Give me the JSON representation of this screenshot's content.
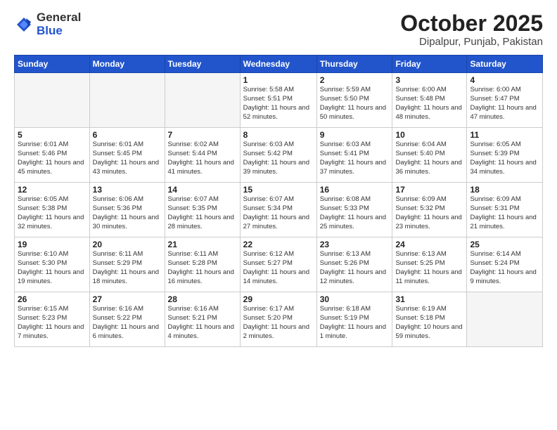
{
  "logo": {
    "general": "General",
    "blue": "Blue"
  },
  "header": {
    "month": "October 2025",
    "location": "Dipalpur, Punjab, Pakistan"
  },
  "weekdays": [
    "Sunday",
    "Monday",
    "Tuesday",
    "Wednesday",
    "Thursday",
    "Friday",
    "Saturday"
  ],
  "weeks": [
    [
      {
        "day": "",
        "info": ""
      },
      {
        "day": "",
        "info": ""
      },
      {
        "day": "",
        "info": ""
      },
      {
        "day": "1",
        "info": "Sunrise: 5:58 AM\nSunset: 5:51 PM\nDaylight: 11 hours and 52 minutes."
      },
      {
        "day": "2",
        "info": "Sunrise: 5:59 AM\nSunset: 5:50 PM\nDaylight: 11 hours and 50 minutes."
      },
      {
        "day": "3",
        "info": "Sunrise: 6:00 AM\nSunset: 5:48 PM\nDaylight: 11 hours and 48 minutes."
      },
      {
        "day": "4",
        "info": "Sunrise: 6:00 AM\nSunset: 5:47 PM\nDaylight: 11 hours and 47 minutes."
      }
    ],
    [
      {
        "day": "5",
        "info": "Sunrise: 6:01 AM\nSunset: 5:46 PM\nDaylight: 11 hours and 45 minutes."
      },
      {
        "day": "6",
        "info": "Sunrise: 6:01 AM\nSunset: 5:45 PM\nDaylight: 11 hours and 43 minutes."
      },
      {
        "day": "7",
        "info": "Sunrise: 6:02 AM\nSunset: 5:44 PM\nDaylight: 11 hours and 41 minutes."
      },
      {
        "day": "8",
        "info": "Sunrise: 6:03 AM\nSunset: 5:42 PM\nDaylight: 11 hours and 39 minutes."
      },
      {
        "day": "9",
        "info": "Sunrise: 6:03 AM\nSunset: 5:41 PM\nDaylight: 11 hours and 37 minutes."
      },
      {
        "day": "10",
        "info": "Sunrise: 6:04 AM\nSunset: 5:40 PM\nDaylight: 11 hours and 36 minutes."
      },
      {
        "day": "11",
        "info": "Sunrise: 6:05 AM\nSunset: 5:39 PM\nDaylight: 11 hours and 34 minutes."
      }
    ],
    [
      {
        "day": "12",
        "info": "Sunrise: 6:05 AM\nSunset: 5:38 PM\nDaylight: 11 hours and 32 minutes."
      },
      {
        "day": "13",
        "info": "Sunrise: 6:06 AM\nSunset: 5:36 PM\nDaylight: 11 hours and 30 minutes."
      },
      {
        "day": "14",
        "info": "Sunrise: 6:07 AM\nSunset: 5:35 PM\nDaylight: 11 hours and 28 minutes."
      },
      {
        "day": "15",
        "info": "Sunrise: 6:07 AM\nSunset: 5:34 PM\nDaylight: 11 hours and 27 minutes."
      },
      {
        "day": "16",
        "info": "Sunrise: 6:08 AM\nSunset: 5:33 PM\nDaylight: 11 hours and 25 minutes."
      },
      {
        "day": "17",
        "info": "Sunrise: 6:09 AM\nSunset: 5:32 PM\nDaylight: 11 hours and 23 minutes."
      },
      {
        "day": "18",
        "info": "Sunrise: 6:09 AM\nSunset: 5:31 PM\nDaylight: 11 hours and 21 minutes."
      }
    ],
    [
      {
        "day": "19",
        "info": "Sunrise: 6:10 AM\nSunset: 5:30 PM\nDaylight: 11 hours and 19 minutes."
      },
      {
        "day": "20",
        "info": "Sunrise: 6:11 AM\nSunset: 5:29 PM\nDaylight: 11 hours and 18 minutes."
      },
      {
        "day": "21",
        "info": "Sunrise: 6:11 AM\nSunset: 5:28 PM\nDaylight: 11 hours and 16 minutes."
      },
      {
        "day": "22",
        "info": "Sunrise: 6:12 AM\nSunset: 5:27 PM\nDaylight: 11 hours and 14 minutes."
      },
      {
        "day": "23",
        "info": "Sunrise: 6:13 AM\nSunset: 5:26 PM\nDaylight: 11 hours and 12 minutes."
      },
      {
        "day": "24",
        "info": "Sunrise: 6:13 AM\nSunset: 5:25 PM\nDaylight: 11 hours and 11 minutes."
      },
      {
        "day": "25",
        "info": "Sunrise: 6:14 AM\nSunset: 5:24 PM\nDaylight: 11 hours and 9 minutes."
      }
    ],
    [
      {
        "day": "26",
        "info": "Sunrise: 6:15 AM\nSunset: 5:23 PM\nDaylight: 11 hours and 7 minutes."
      },
      {
        "day": "27",
        "info": "Sunrise: 6:16 AM\nSunset: 5:22 PM\nDaylight: 11 hours and 6 minutes."
      },
      {
        "day": "28",
        "info": "Sunrise: 6:16 AM\nSunset: 5:21 PM\nDaylight: 11 hours and 4 minutes."
      },
      {
        "day": "29",
        "info": "Sunrise: 6:17 AM\nSunset: 5:20 PM\nDaylight: 11 hours and 2 minutes."
      },
      {
        "day": "30",
        "info": "Sunrise: 6:18 AM\nSunset: 5:19 PM\nDaylight: 11 hours and 1 minute."
      },
      {
        "day": "31",
        "info": "Sunrise: 6:19 AM\nSunset: 5:18 PM\nDaylight: 10 hours and 59 minutes."
      },
      {
        "day": "",
        "info": ""
      }
    ]
  ]
}
